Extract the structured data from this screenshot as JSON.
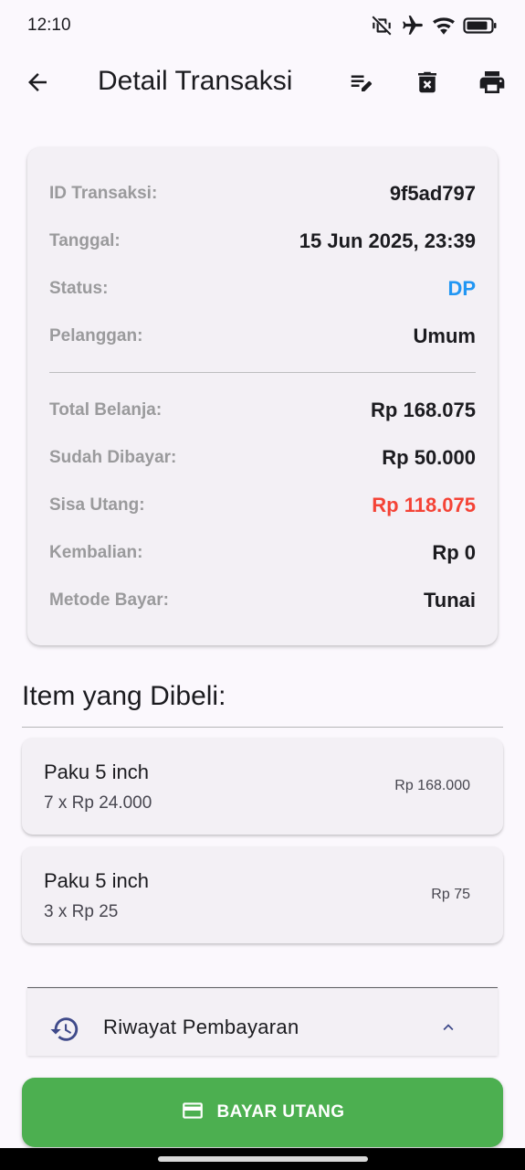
{
  "status_bar": {
    "time": "12:10",
    "icons": [
      "vibrate-off-icon",
      "airplane-icon",
      "wifi-icon",
      "battery-icon"
    ]
  },
  "app_bar": {
    "title": "Detail Transaksi",
    "back_icon": "arrow-left-icon",
    "actions": [
      "edit-note-icon",
      "delete-icon",
      "print-icon"
    ]
  },
  "summary": {
    "rows": [
      {
        "label": "ID Transaksi:",
        "value": "9f5ad797"
      },
      {
        "label": "Tanggal:",
        "value": "15 Jun 2025, 23:39"
      },
      {
        "label": "Status:",
        "value": "DP"
      },
      {
        "label": "Pelanggan:",
        "value": "Umum"
      },
      {
        "label": "Total Belanja:",
        "value": "Rp 168.075"
      },
      {
        "label": "Sudah Dibayar:",
        "value": "Rp 50.000"
      },
      {
        "label": "Sisa Utang:",
        "value": "Rp 118.075"
      },
      {
        "label": "Kembalian:",
        "value": "Rp 0"
      },
      {
        "label": "Metode Bayar:",
        "value": "Tunai"
      }
    ]
  },
  "items_section": {
    "title": "Item yang Dibeli:",
    "items": [
      {
        "name": "Paku 5 inch",
        "qty": "7 x Rp 24.000",
        "price": "Rp 168.000"
      },
      {
        "name": "Paku 5 inch",
        "qty": "3 x Rp 25",
        "price": "Rp 75"
      }
    ]
  },
  "history": {
    "label": "Riwayat Pembayaran",
    "icon": "history-icon",
    "toggle_icon": "chevron-up-icon"
  },
  "pay_button": {
    "label": "BAYAR UTANG",
    "icon": "credit-card-icon"
  },
  "colors": {
    "status_blue": "#2196f3",
    "debt_red": "#f44336",
    "pay_green": "#4caf50",
    "accent_indigo": "#3f4a8a"
  }
}
